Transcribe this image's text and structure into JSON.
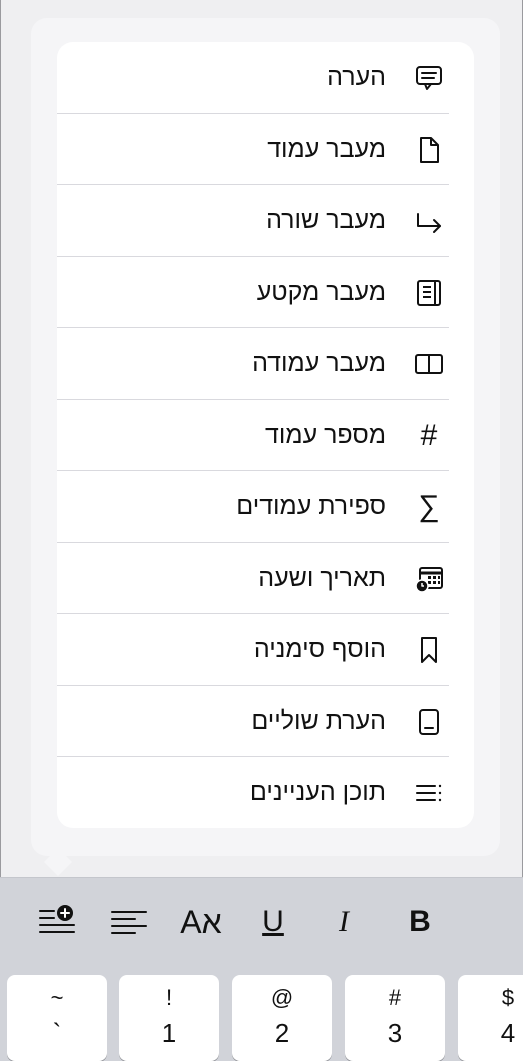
{
  "menu": {
    "items": [
      {
        "label": "הערה",
        "icon": "comment-icon"
      },
      {
        "label": "מעבר עמוד",
        "icon": "page-icon"
      },
      {
        "label": "מעבר שורה",
        "icon": "line-break-arrow-icon"
      },
      {
        "label": "מעבר מקטע",
        "icon": "section-icon"
      },
      {
        "label": "מעבר עמודה",
        "icon": "column-icon"
      },
      {
        "label": "מספר עמוד",
        "icon": "hash-icon",
        "glyph": "#"
      },
      {
        "label": "ספירת עמודים",
        "icon": "sigma-icon",
        "glyph": "∑"
      },
      {
        "label": "תאריך ושעה",
        "icon": "calendar-clock-icon"
      },
      {
        "label": "הוסף סימניה",
        "icon": "bookmark-icon"
      },
      {
        "label": "הערת שוליים",
        "icon": "footnote-icon"
      },
      {
        "label": "תוכן העניינים",
        "icon": "table-of-contents-icon"
      }
    ]
  },
  "toolbar": {
    "insert": "insert-plus-icon",
    "align": "align-left-icon",
    "font_label": "Aא",
    "underline_label": "U",
    "italic_label": "I",
    "bold_label": "B"
  },
  "keyboard": {
    "keys": [
      {
        "top": "~",
        "bottom": "`"
      },
      {
        "top": "!",
        "bottom": "1"
      },
      {
        "top": "@",
        "bottom": "2"
      },
      {
        "top": "#",
        "bottom": "3"
      },
      {
        "top": "$",
        "bottom": "4"
      }
    ]
  }
}
